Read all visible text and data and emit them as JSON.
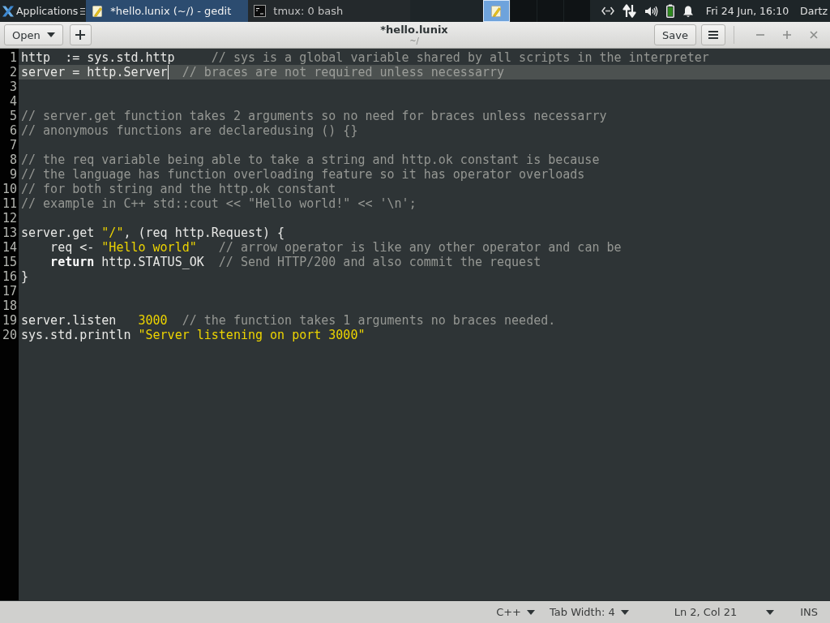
{
  "panel": {
    "applications": "Applications",
    "tasks": [
      {
        "kind": "editor",
        "title": "*hello.lunix (~/) - gedit",
        "selected": true
      },
      {
        "kind": "terminal",
        "title": "tmux: 0 bash",
        "selected": false
      }
    ],
    "workspaces": [
      {
        "selected": true,
        "has_window": true
      },
      {
        "selected": false,
        "has_window": false
      },
      {
        "selected": false,
        "has_window": false
      },
      {
        "selected": false,
        "has_window": false
      }
    ],
    "clock": "Fri 24 Jun, 16:10",
    "user": "Dartz"
  },
  "header": {
    "open_button": "Open",
    "title": "*hello.lunix",
    "subtitle": "~/",
    "save_button": "Save"
  },
  "editor": {
    "lines": [
      {
        "number": "1",
        "current": false,
        "tokens": [
          {
            "kind": "plain",
            "text": "http  := sys.std.http     "
          },
          {
            "kind": "comment",
            "text": "// sys is a global variable shared by all scripts in the interpreter"
          }
        ]
      },
      {
        "number": "2",
        "current": true,
        "tokens": [
          {
            "kind": "plain",
            "text": "server = http.Server"
          },
          {
            "kind": "cursor"
          },
          {
            "kind": "comment",
            "text": "  // braces are not required unless necessarry"
          }
        ]
      },
      {
        "number": "3",
        "current": false
      },
      {
        "number": "4",
        "current": false
      },
      {
        "number": "5",
        "current": false,
        "tokens": [
          {
            "kind": "comment",
            "text": "// server.get function takes 2 arguments so no need for braces unless necessarry"
          }
        ]
      },
      {
        "number": "6",
        "current": false,
        "tokens": [
          {
            "kind": "comment",
            "text": "// anonymous functions are declaredusing () {}"
          }
        ]
      },
      {
        "number": "7",
        "current": false
      },
      {
        "number": "8",
        "current": false,
        "tokens": [
          {
            "kind": "comment",
            "text": "// the req variable being able to take a string and http.ok constant is because"
          }
        ]
      },
      {
        "number": "9",
        "current": false,
        "tokens": [
          {
            "kind": "comment",
            "text": "// the language has function overloading feature so it has operator overloads"
          }
        ]
      },
      {
        "number": "10",
        "current": false,
        "tokens": [
          {
            "kind": "comment",
            "text": "// for both string and the http.ok constant"
          }
        ]
      },
      {
        "number": "11",
        "current": false,
        "tokens": [
          {
            "kind": "comment",
            "text": "// example in C++ std::cout << \"Hello world!\" << '\\n';"
          }
        ]
      },
      {
        "number": "12",
        "current": false
      },
      {
        "number": "13",
        "current": false,
        "tokens": [
          {
            "kind": "plain",
            "text": "server.get "
          },
          {
            "kind": "string",
            "text": "\"/\""
          },
          {
            "kind": "plain",
            "text": ", (req http.Request) {"
          }
        ]
      },
      {
        "number": "14",
        "current": false,
        "tokens": [
          {
            "kind": "plain",
            "text": "    req <- "
          },
          {
            "kind": "string",
            "text": "\"Hello world\""
          },
          {
            "kind": "comment",
            "text": "   // arrow operator is like any other operator and can be"
          }
        ]
      },
      {
        "number": "15",
        "current": false,
        "tokens": [
          {
            "kind": "keyword",
            "text": "    return"
          },
          {
            "kind": "plain",
            "text": " http.STATUS_OK  "
          },
          {
            "kind": "comment",
            "text": "// Send HTTP/200 and also commit the request"
          }
        ]
      },
      {
        "number": "16",
        "current": false,
        "tokens": [
          {
            "kind": "plain",
            "text": "}"
          }
        ]
      },
      {
        "number": "17",
        "current": false
      },
      {
        "number": "18",
        "current": false
      },
      {
        "number": "19",
        "current": false,
        "tokens": [
          {
            "kind": "plain",
            "text": "server.listen   "
          },
          {
            "kind": "number",
            "text": "3000"
          },
          {
            "kind": "comment",
            "text": "  // the function takes 1 arguments no braces needed."
          }
        ]
      },
      {
        "number": "20",
        "current": false,
        "tokens": [
          {
            "kind": "plain",
            "text": "sys.std.println "
          },
          {
            "kind": "string",
            "text": "\"Server listening on port 3000\""
          }
        ]
      }
    ]
  },
  "status_bar": {
    "language": "C++",
    "tab_width": "Tab Width: 4",
    "position": "Ln 2, Col 21",
    "mode": "INS"
  }
}
